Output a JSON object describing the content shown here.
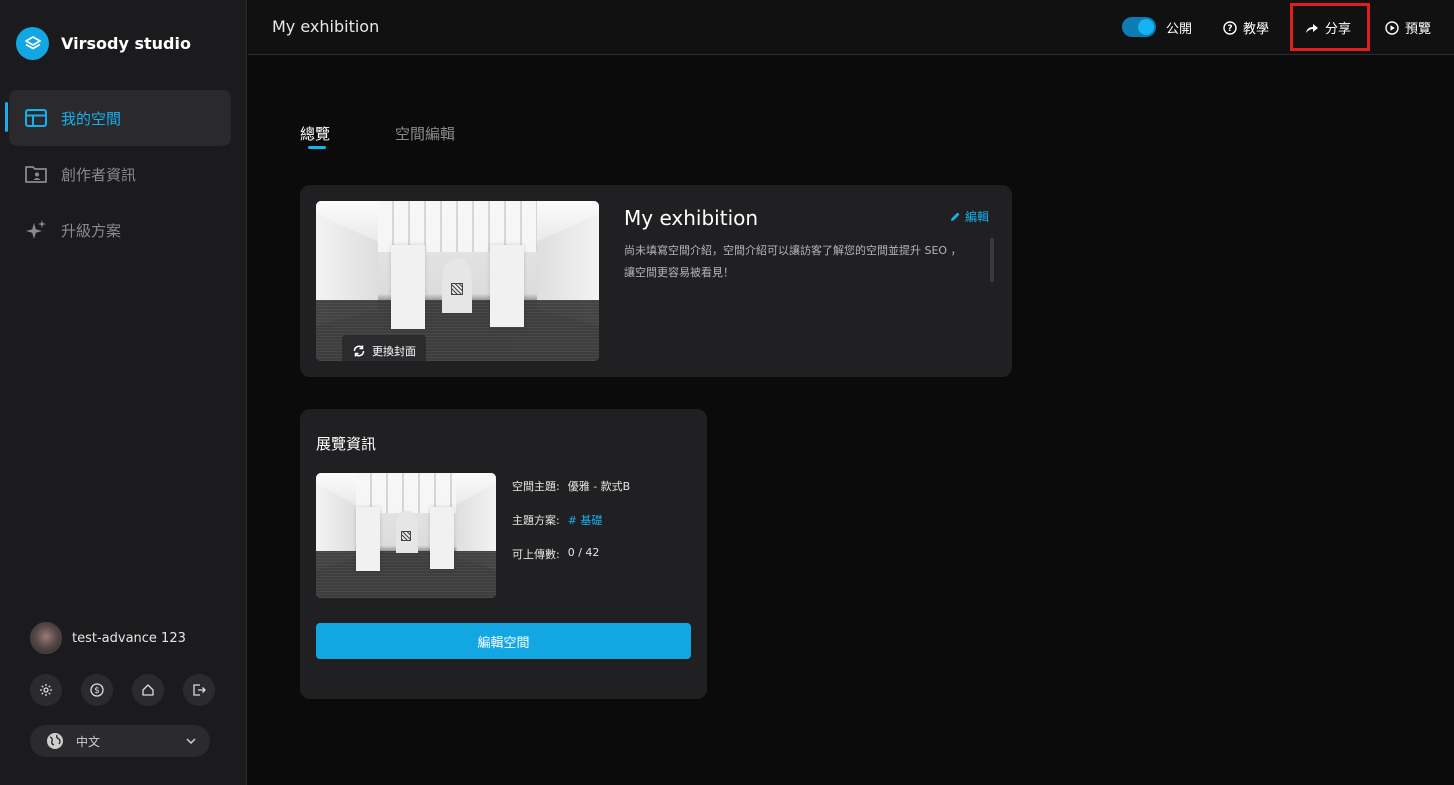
{
  "app": {
    "name": "Virsody studio",
    "accent": "#12a6e3"
  },
  "sidebar": {
    "items": [
      {
        "label": "我的空間",
        "icon": "layout-icon",
        "active": true
      },
      {
        "label": "創作者資訊",
        "icon": "folder-user-icon",
        "active": false
      },
      {
        "label": "升級方案",
        "icon": "sparkles-icon",
        "active": false
      }
    ],
    "user": {
      "name": "test-advance 123"
    },
    "actions": [
      "settings-icon",
      "dollar-icon",
      "home-icon",
      "logout-icon"
    ],
    "language": {
      "selected": "中文"
    }
  },
  "topbar": {
    "title": "My exhibition",
    "public_label": "公開",
    "public_on": true,
    "tutorial_label": "教學",
    "share_label": "分享",
    "preview_label": "預覽"
  },
  "tabs": [
    {
      "label": "總覽",
      "active": true
    },
    {
      "label": "空間編輯",
      "active": false
    }
  ],
  "overview": {
    "change_cover_label": "更換封面",
    "space_title": "My exhibition",
    "edit_label": "編輯",
    "description": "尚未填寫空間介紹，空間介紹可以讓訪客了解您的空間並提升 SEO ，讓空間更容易被看見！"
  },
  "exhibition_info": {
    "title": "展覽資訊",
    "theme_label": "空間主題:",
    "theme_value": "優雅 - 款式B",
    "plan_label": "主題方案:",
    "plan_value": "# 基礎",
    "upload_label": "可上傳數:",
    "upload_value": "0 / 42",
    "edit_button": "編輯空間"
  }
}
